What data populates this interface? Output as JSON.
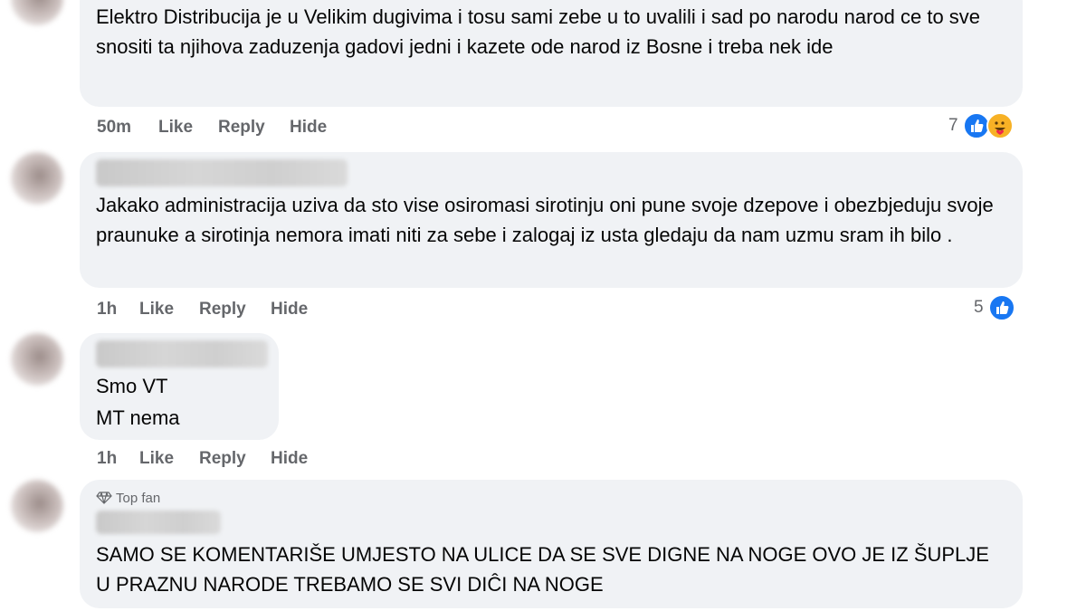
{
  "comments": [
    {
      "text": "Elektro Distribucija je u Velikim dugivima i tosu sami zebe u to uvalili i sad po narodu narod ce to sve snositi ta njihova zaduzenja gadovi jedni i kazete ode narod iz Bosne i treba nek ide",
      "time": "50m",
      "like": "Like",
      "reply": "Reply",
      "hide": "Hide",
      "reaction_count": "7",
      "reactions": [
        "like-icon",
        "care-icon"
      ]
    },
    {
      "text": "Jakako administracija uziva da sto vise osiromasi sirotinju oni pune svoje dzepove i obezbjeduju svoje praunuke a sirotinja nemora imati niti za sebe i zalogaj iz usta gledaju da nam uzmu sram ih bilo .",
      "time": "1h",
      "like": "Like",
      "reply": "Reply",
      "hide": "Hide",
      "reaction_count": "5",
      "reactions": [
        "like-icon"
      ]
    },
    {
      "line1": "Smo VT",
      "line2": "MT nema",
      "time": "1h",
      "like": "Like",
      "reply": "Reply",
      "hide": "Hide"
    },
    {
      "badge": "Top fan",
      "text": "SAMO SE KOMENTARIŠE UMJESTO NA ULICE DA SE SVE DIGNE NA NOGE OVO JE IZ ŠUPLJE U PRAZNU NARODE TREBAMO SE SVI DIĈI NA NOGE"
    }
  ],
  "colors": {
    "bubble": "#f0f2f5",
    "meta": "#65676b",
    "like_blue": "#1877f2",
    "care_yellow": "#f7b125"
  }
}
